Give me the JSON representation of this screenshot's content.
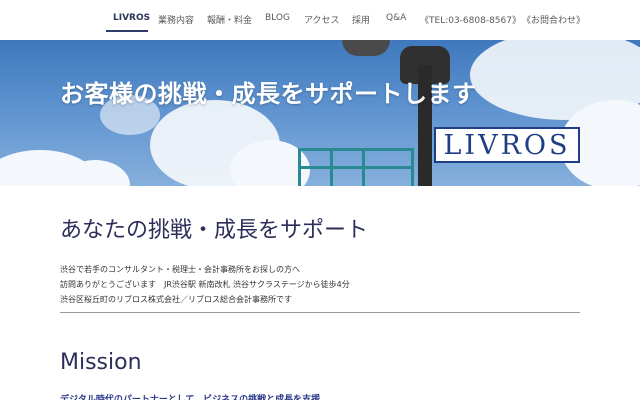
{
  "nav": {
    "items": [
      {
        "label": "LIVROS",
        "active": true
      },
      {
        "label": "業務内容"
      },
      {
        "label": "報酬・料金"
      },
      {
        "label": "BLOG"
      },
      {
        "label": "アクセス"
      },
      {
        "label": "採用"
      },
      {
        "label": "Q&A"
      },
      {
        "label": "《TEL:03-6808-8567》"
      },
      {
        "label": "《お問合わせ》"
      }
    ]
  },
  "hero": {
    "title": "お客様の挑戦・成長をサポートします",
    "logo": "LIVROS"
  },
  "section": {
    "title": "あなたの挑戦・成長をサポート",
    "lines": [
      "渋谷で若手のコンサルタント・税理士・会計事務所をお探しの方へ",
      "訪問ありがとうございます　JR渋谷駅 新南改札 渋谷サクラステージから徒歩4分",
      "渋谷区桜丘町のリブロス株式会社／リブロス総合会計事務所です"
    ]
  },
  "mission": {
    "title": "Mission",
    "subtitle": "デジタル時代のパートナーとして、ビジネスの挑戦と成長を支援"
  },
  "colors": {
    "accent": "#2f3c6b",
    "heading": "#2d2f5a",
    "logo": "#1f3e86"
  }
}
